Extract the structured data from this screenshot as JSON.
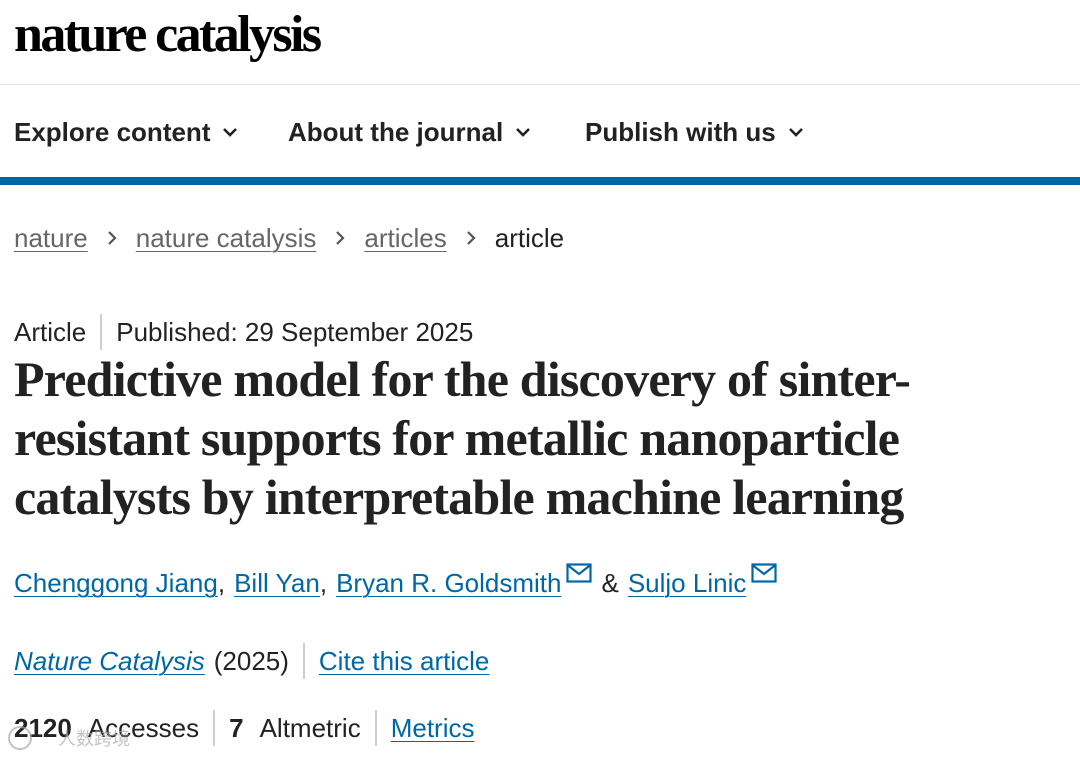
{
  "brand": {
    "logo_text": "nature catalysis"
  },
  "nav": {
    "items": [
      {
        "label": "Explore content"
      },
      {
        "label": "About the journal"
      },
      {
        "label": "Publish with us"
      }
    ]
  },
  "breadcrumb": {
    "items": [
      "nature",
      "nature catalysis",
      "articles"
    ],
    "current": "article"
  },
  "article": {
    "type": "Article",
    "published": "Published: 29 September 2025",
    "title": "Predictive model for the discovery of sinter-resistant supports for metallic nanoparticle catalysts by interpretable machine learning",
    "authors": [
      "Chenggong Jiang",
      "Bill Yan",
      "Bryan R. Goldsmith",
      "Suljo Linic"
    ],
    "author_separator": ",",
    "author_and": "&",
    "journal": "Nature Catalysis",
    "year": "(2025)",
    "cite_label": "Cite this article"
  },
  "metrics": {
    "accesses_value": "2120",
    "accesses_label": "Accesses",
    "altmetric_value": "7",
    "altmetric_label": "Altmetric",
    "metrics_link": "Metrics"
  },
  "watermark": {
    "text": "人数跨境"
  },
  "colors": {
    "link": "#0067a5",
    "accent_bar": "#0067a5",
    "text": "#222222",
    "muted": "#666666"
  },
  "icons": [
    "chevron-down-icon",
    "chevron-right-icon",
    "mail-icon"
  ]
}
